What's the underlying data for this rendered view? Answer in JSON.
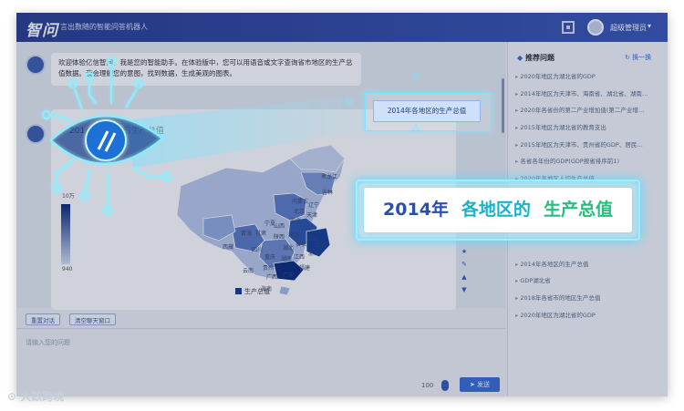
{
  "header": {
    "logo": "智问",
    "slogan": "言出数随的智能问答机器人",
    "username": "超级管理员"
  },
  "chat": {
    "greeting": "欢迎体验亿信智问，我是您的智能助手。在体验版中，您可以用语音或文字查询省市地区的生产总值数据。我会理解您的意图，找到数据，生成美观的图表。",
    "chart_title": "2014年各地区的生产总值",
    "legend_max": "10万",
    "legend_min": "940",
    "legend_label": "生产总值",
    "map_labels": [
      "黑龙江",
      "吉林",
      "内蒙古",
      "辽宁",
      "北京",
      "天津",
      "河北",
      "山西",
      "山东",
      "宁夏",
      "青海",
      "甘肃",
      "陕西",
      "河南",
      "江苏",
      "西藏",
      "四川",
      "湖北",
      "安徽",
      "上海",
      "重庆",
      "湖南",
      "江西",
      "浙江",
      "云南",
      "贵州",
      "福建",
      "广西",
      "广东",
      "海南"
    ]
  },
  "actions": {
    "reset": "重置对话",
    "clear": "清空聊天窗口"
  },
  "input": {
    "placeholder": "请输入您的问题",
    "count": "100",
    "send": "发送"
  },
  "sidebar": {
    "title": "推荐问题",
    "refresh": "换一换",
    "items": [
      "2020年地区为湖北省的GDP",
      "2014年地区为天津市、海南省、湖北省、湖南…",
      "2020年各省份的第二产业增加值(第二产业增…",
      "2015年地区为湖北省的教育支出",
      "2015年地区为天津市、贵州省的GDP、居民…",
      "各省各年份的GDP(GDP按省排序前1)",
      "2020年各地区人均生产总值",
      "",
      "",
      "",
      "",
      "2014年各地区的生产总值",
      "GDP湖北省",
      "2018年各省市的地区生产总值",
      "2020年地区为湖北省的GDP"
    ]
  },
  "overlay": {
    "small_label": "2014年各地区的生产总值",
    "seg1": "2014年",
    "seg2": "各地区的",
    "seg3": "生产总值"
  },
  "watermark": "大数跨境"
}
